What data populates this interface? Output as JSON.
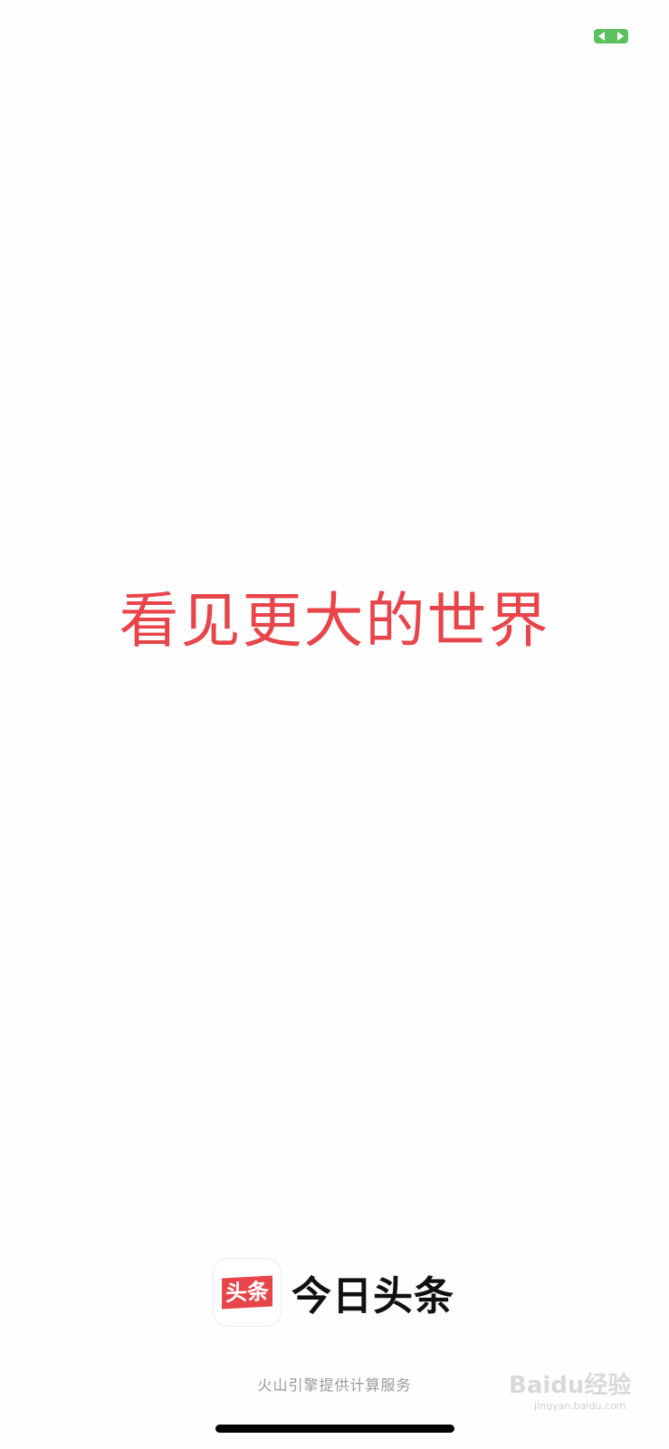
{
  "colors": {
    "accent_red": "#e8454b",
    "accent_green": "#5cc05f"
  },
  "status_bar": {
    "indicator_icon": "swap-arrows-icon"
  },
  "splash": {
    "slogan": "看见更大的世界"
  },
  "brand": {
    "icon_text": "头条",
    "name": "今日头条"
  },
  "footer": {
    "text": "火山引擎提供计算服务"
  },
  "watermark": {
    "text": "Baidu经验",
    "subtext": "jingyan.baidu.com"
  }
}
